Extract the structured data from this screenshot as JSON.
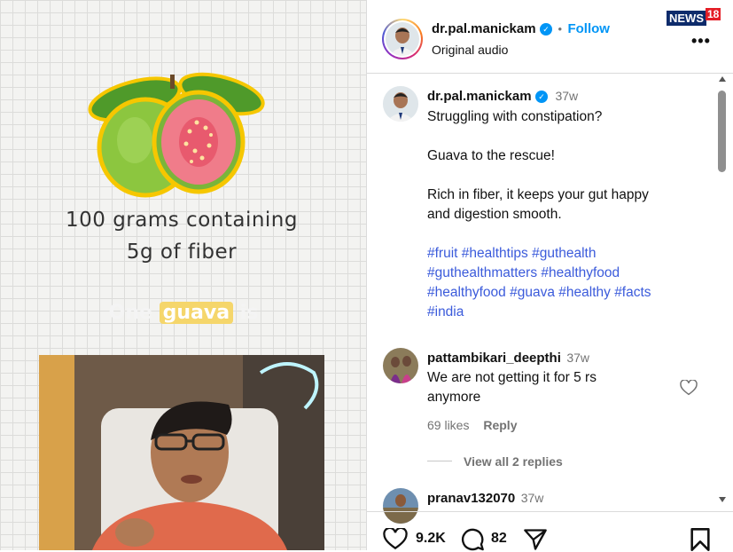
{
  "video": {
    "caption_line1": "100 grams containing",
    "caption_line2": "5g of fiber",
    "caption_one": "One",
    "caption_guava": "guava",
    "caption_is": "is"
  },
  "header": {
    "username": "dr.pal.manickam",
    "separator": "•",
    "follow_label": "Follow",
    "audio": "Original audio",
    "badge_news": "NEWS",
    "badge_num": "18"
  },
  "post": {
    "username": "dr.pal.manickam",
    "age": "37w",
    "lines": [
      "Struggling with constipation?",
      "Guava to the rescue!",
      "Rich in fiber, it keeps your gut happy",
      "and digestion smooth."
    ],
    "hashtags": [
      [
        "#fruit",
        "#healthtips",
        "#guthealth"
      ],
      [
        "#guthealthmatters",
        "#healthyfood"
      ],
      [
        "#healthyfood",
        "#guava",
        "#healthy",
        "#facts"
      ],
      [
        "#india"
      ]
    ]
  },
  "comments": [
    {
      "username": "pattambikari_deepthi",
      "age": "37w",
      "text_line1": "We are not getting it for 5 rs",
      "text_line2": "anymore",
      "likes": "69 likes",
      "reply": "Reply",
      "view_replies": "View all 2 replies"
    },
    {
      "username": "pranav132070",
      "age": "37w"
    }
  ],
  "footer": {
    "likes_count": "9.2K",
    "comments_count": "82"
  },
  "icons": {
    "verified": "verified-badge-icon",
    "more": "more-options-icon",
    "heart": "heart-icon",
    "comment": "comment-icon",
    "share": "share-icon",
    "save": "bookmark-icon"
  },
  "colors": {
    "link": "#0095f6",
    "hashtag": "#3b5bdb",
    "muted": "#737373",
    "guava_skin": "#8cc63f",
    "guava_flesh": "#f07c8a",
    "highlight": "#f5d66b"
  }
}
